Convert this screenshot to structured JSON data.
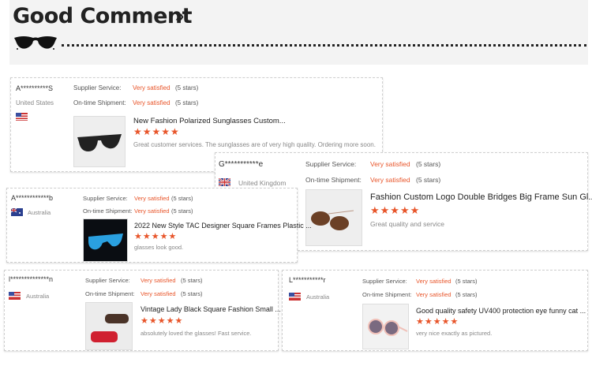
{
  "header": {
    "title": "Good Comment",
    "chevron": "»"
  },
  "labels": {
    "supplier": "Supplier Service:",
    "shipment": "On-time Shipment:"
  },
  "stars_glyph": "★★★★★",
  "reviews": [
    {
      "name": "A**********S",
      "country": "United States",
      "flag": "us-flag",
      "supplier": "Very satisfied",
      "supplier_stars": "(5 stars)",
      "shipment": "Very satisfied",
      "shipment_stars": "(5 stars)",
      "product": "New Fashion Polarized Sunglasses Custom...",
      "rating": 5,
      "comment": "Great customer services. The sunglasses are of very high quality. Ordering more soon."
    },
    {
      "name": "G***********e",
      "country": "United Kingdom",
      "flag": "uk-flag",
      "supplier": "Very satisfied",
      "supplier_stars": "(5 stars)",
      "shipment": "Very satisfied",
      "shipment_stars": "(5 stars)",
      "product": "Fashion Custom Logo Double Bridges Big Frame Sun Gl...",
      "rating": 5,
      "comment": "Great quality and service"
    },
    {
      "name": "A************b",
      "country": "Australia",
      "flag": "au-flag",
      "supplier": "Very satisfied",
      "supplier_stars": "(5 stars)",
      "shipment": "Very satisfied",
      "shipment_stars": "(5 stars)",
      "product": "2022 New Style TAC Designer Square Frames Plastic ...",
      "rating": 5,
      "comment": "glasses look good."
    },
    {
      "name": "l**************n",
      "country": "Australia",
      "flag": "us-flag",
      "supplier": "Very satisfied",
      "supplier_stars": "(5 stars)",
      "shipment": "Very satisfied",
      "shipment_stars": "(5 stars)",
      "product": "Vintage Lady Black Square Fashion Small ...",
      "rating": 5,
      "comment": "absolutely loved the glasses! Fast service."
    },
    {
      "name": "L***********r",
      "country": "Australia",
      "flag": "us-flag",
      "supplier": "Very satisfied",
      "supplier_stars": "(5 stars)",
      "shipment": "Very satisfied",
      "shipment_stars": "(5 stars)",
      "product": "Good quality safety UV400 protection eye funny cat ...",
      "rating": 5,
      "comment": "very nice exactly as pictured."
    }
  ]
}
